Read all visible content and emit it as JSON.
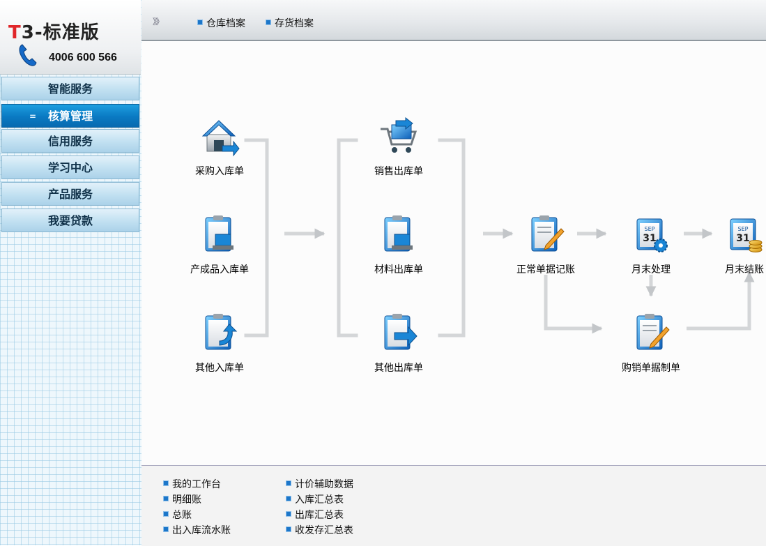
{
  "brand": {
    "logo_t": "T",
    "logo_rest": "3-标准版",
    "phone": "4006 600 566"
  },
  "sidebar": {
    "items": [
      {
        "label": "智能服务",
        "active": false
      },
      {
        "label": "核算管理",
        "active": true
      },
      {
        "label": "信用服务",
        "active": false
      },
      {
        "label": "学习中心",
        "active": false
      },
      {
        "label": "产品服务",
        "active": false
      },
      {
        "label": "我要贷款",
        "active": false
      }
    ],
    "active_bullet": "=",
    "colors": {
      "active": "#0a79c2",
      "inactive": "#c1e0f1"
    }
  },
  "topbar": {
    "chevron": "》》",
    "links": [
      {
        "label": "仓库档案"
      },
      {
        "label": "存货档案"
      }
    ]
  },
  "flow": {
    "in": [
      {
        "label": "采购入库单",
        "icon": "house-icon"
      },
      {
        "label": "产成品入库单",
        "icon": "clipboard-computer-icon"
      },
      {
        "label": "其他入库单",
        "icon": "clipboard-arrow-icon"
      }
    ],
    "out": [
      {
        "label": "销售出库单",
        "icon": "cart-icon"
      },
      {
        "label": "材料出库单",
        "icon": "clipboard-computer-icon"
      },
      {
        "label": "其他出库单",
        "icon": "clipboard-arrow-icon"
      }
    ],
    "post": {
      "label": "正常单据记账",
      "icon": "clipboard-pen-icon"
    },
    "month_process": {
      "label": "月末处理",
      "icon": "calendar-gear-icon"
    },
    "month_close": {
      "label": "月末结账",
      "icon": "calendar-coins-icon"
    },
    "purchase_sales": {
      "label": "购销单据制单",
      "icon": "clipboard-pen-icon"
    },
    "calendar_month": "SEP",
    "calendar_day": "31"
  },
  "bottom": {
    "col1": [
      {
        "label": "我的工作台"
      },
      {
        "label": "明细账"
      },
      {
        "label": "总账"
      },
      {
        "label": "出入库流水账"
      }
    ],
    "col2": [
      {
        "label": "计价辅助数据"
      },
      {
        "label": "入库汇总表"
      },
      {
        "label": "出库汇总表"
      },
      {
        "label": "收发存汇总表"
      }
    ]
  }
}
